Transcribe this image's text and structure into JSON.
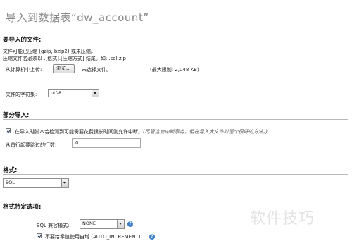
{
  "page": {
    "title": "导入到数据表“dw_account”"
  },
  "file_section": {
    "heading": "要导入的文件:",
    "line1": "文件可能已压缩 (gzip, bzip2) 或未压缩。",
    "line2": "压缩文件名必须以 .[格式].[压缩方式] 结尾。如: .sql.zip",
    "upload_label": "从计算机中上传:",
    "browse_button": "浏览...",
    "no_file": "未选择文件。",
    "max_size": "(最大限制: 2,048 KB)",
    "charset_label": "文件的字符集:",
    "charset_value": "utf-8"
  },
  "partial_section": {
    "heading": "部分导入:",
    "interrupt_label": "在导入时脚本若检测到可能需要花费很长时间则允许中断。",
    "interrupt_note": "(尽管这会中断事务，但在导入大文件时是个很好的方法。)",
    "interrupt_checked": true,
    "skip_label": "从首行起要跳过的行数:",
    "skip_value": "0"
  },
  "format_section": {
    "heading": "格式:",
    "format_value": "SQL"
  },
  "format_options_section": {
    "heading": "格式特定选项:",
    "compat_label": "SQL 兼容模式:",
    "compat_value": "NONE",
    "auto_increment_label": "不要给零值使用自增 (AUTO_INCREMENT)",
    "auto_increment_checked": true,
    "help_icon_glyph": "?"
  },
  "watermark": {
    "text": "软件技巧"
  }
}
